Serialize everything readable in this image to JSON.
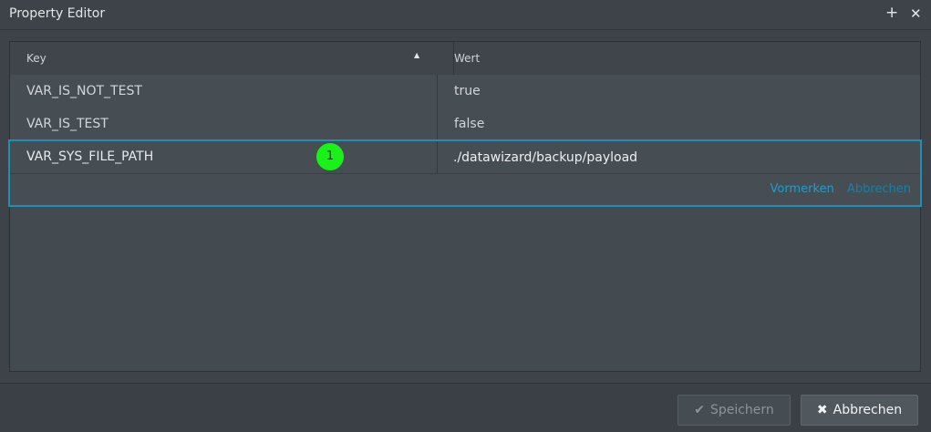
{
  "window": {
    "title": "Property Editor",
    "plus_icon": "+",
    "close_icon": "✕"
  },
  "grid": {
    "columns": {
      "key": "Key",
      "value": "Wert"
    },
    "sort_indicator": "▲",
    "rows": [
      {
        "key": "VAR_IS_NOT_TEST",
        "value": "true"
      },
      {
        "key": "VAR_IS_TEST",
        "value": "false"
      }
    ],
    "editing": {
      "key": "VAR_SYS_FILE_PATH",
      "value": "./datawizard/backup/payload",
      "marker_label": "1",
      "marker_color": "#19f219",
      "submit_link": "Vormerken",
      "cancel_link": "Abbrechen"
    }
  },
  "footer": {
    "save_label": "Speichern",
    "save_icon": "✔",
    "cancel_label": "Abbrechen",
    "cancel_icon": "✖"
  },
  "colors": {
    "accent": "#1f8fb3",
    "link": "#1e9fd0",
    "background": "#3d4349"
  }
}
